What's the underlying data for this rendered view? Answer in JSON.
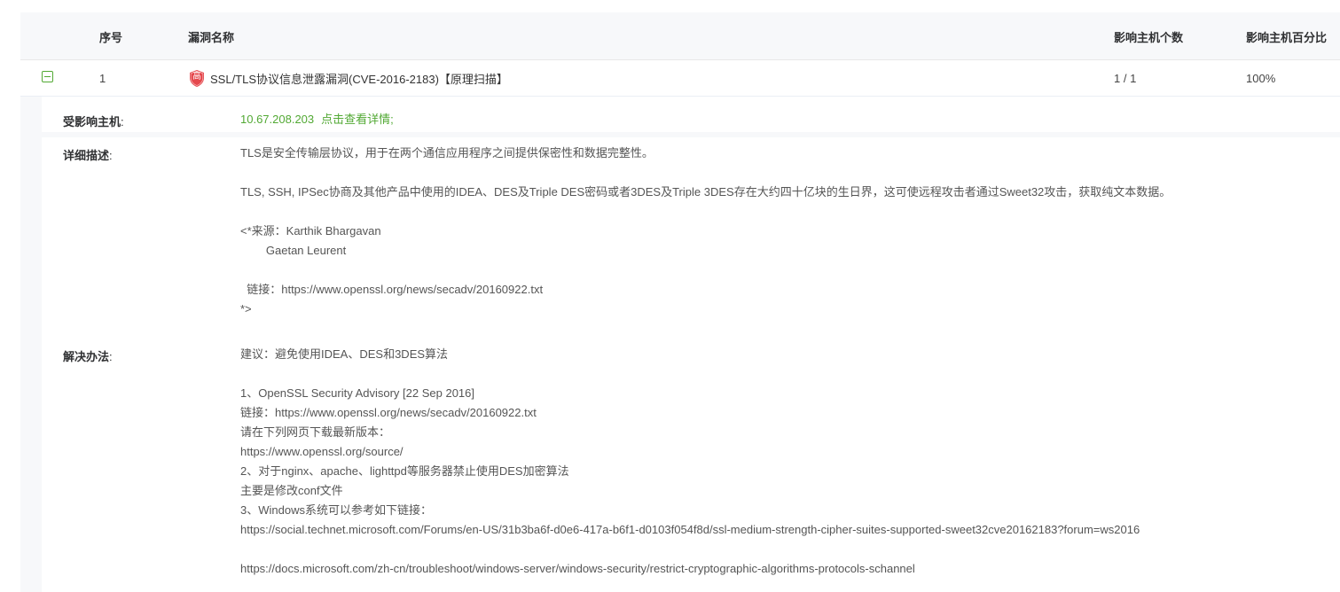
{
  "table": {
    "headers": {
      "index": "序号",
      "name": "漏洞名称",
      "host_count": "影响主机个数",
      "host_percent": "影响主机百分比"
    },
    "row": {
      "index": "1",
      "level_badge": "高",
      "level_color": "#e5484d",
      "name": "SSL/TLS协议信息泄露漏洞(CVE-2016-2183)【原理扫描】",
      "host_count": "1 / 1",
      "host_percent": "100%",
      "expand_icon": "collapse-minus-icon"
    }
  },
  "details": {
    "affected_hosts": {
      "label": "受影响主机",
      "colon": ":",
      "ip": "10.67.208.203",
      "link": "点击查看详情;"
    },
    "description": {
      "label": "详细描述",
      "colon": ":",
      "text": "TLS是安全传输层协议，用于在两个通信应用程序之间提供保密性和数据完整性。\n\nTLS, SSH, IPSec协商及其他产品中使用的IDEA、DES及Triple DES密码或者3DES及Triple 3DES存在大约四十亿块的生日界，这可使远程攻击者通过Sweet32攻击，获取纯文本数据。\n\n<*来源：Karthik Bhargavan\n        Gaetan Leurent\n\n  链接：https://www.openssl.org/news/secadv/20160922.txt\n*>"
    },
    "solution": {
      "label": "解决办法",
      "colon": ":",
      "text": "建议：避免使用IDEA、DES和3DES算法\n\n1、OpenSSL Security Advisory [22 Sep 2016]\n链接：https://www.openssl.org/news/secadv/20160922.txt\n请在下列网页下载最新版本：\nhttps://www.openssl.org/source/\n2、对于nginx、apache、lighttpd等服务器禁止使用DES加密算法\n主要是修改conf文件\n3、Windows系统可以参考如下链接：\nhttps://social.technet.microsoft.com/Forums/en-US/31b3ba6f-d0e6-417a-b6f1-d0103f054f8d/ssl-medium-strength-cipher-suites-supported-sweet32cve20162183?forum=ws2016\n\nhttps://docs.microsoft.com/zh-cn/troubleshoot/windows-server/windows-security/restrict-cryptographic-algorithms-protocols-schannel"
    }
  }
}
